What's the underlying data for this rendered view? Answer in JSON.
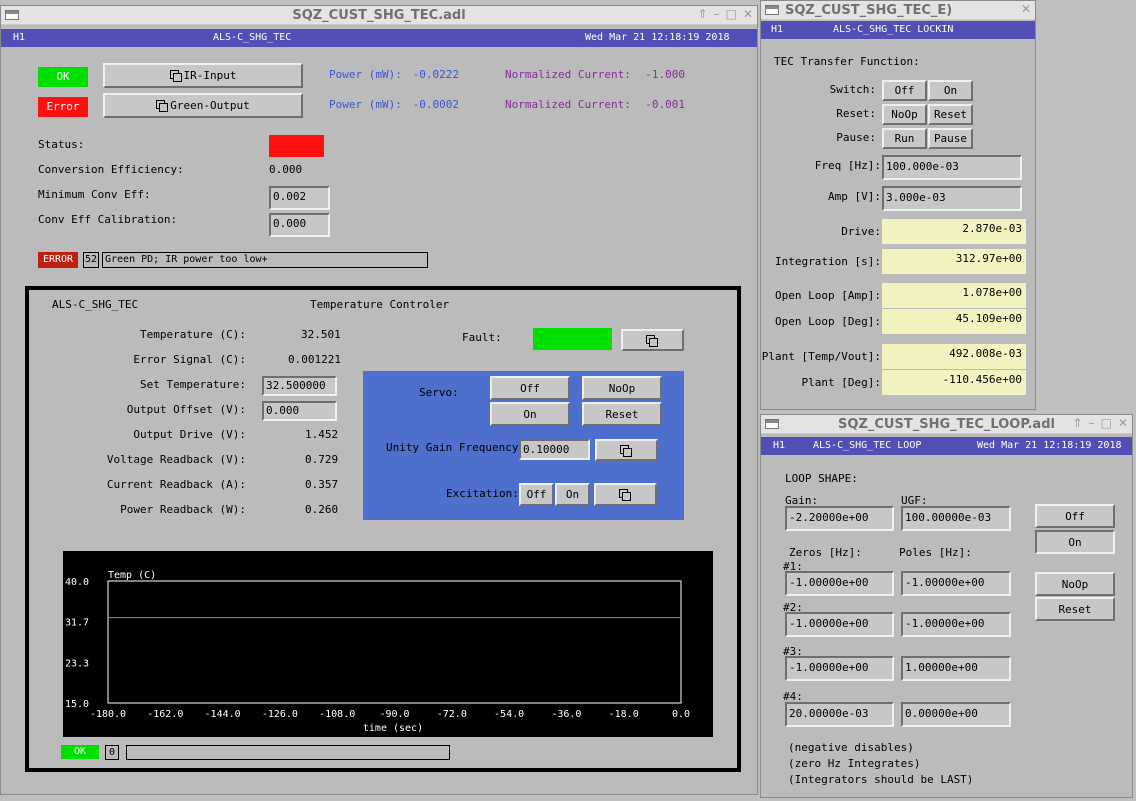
{
  "colors": {
    "header_bg": "#514eb6",
    "ok_green": "#00e000",
    "error_red": "#ff1010",
    "error_dark": "#c02010",
    "servo_panel": "#4e6fce",
    "readback_yellow": "#f3f3c2",
    "trace_green": "#2fd12f",
    "power_label_blue": "#3a55d8",
    "current_label_purple": "#8a2a9c"
  },
  "main": {
    "title": "SQZ_CUST_SHG_TEC.adl",
    "ifo": "H1",
    "system": "ALS-C_SHG_TEC",
    "datetime": "Wed Mar 21 12:18:19 2018",
    "ok_label": "OK",
    "error_label": "Error",
    "ir_button": "IR-Input",
    "green_button": "Green-Output",
    "power_label": "Power (mW):",
    "ir_power": "-0.0222",
    "green_power": "-0.0002",
    "norm_label": "Normalized Current:",
    "ir_norm": "-1.000",
    "green_norm": "-0.001",
    "status_label": "Status:",
    "conv_eff_label": "Conversion Efficiency:",
    "conv_eff_value": "0.000",
    "min_conv_label": "Minimum Conv Eff:",
    "min_conv_value": "0.002",
    "calib_label": "Conv Eff Calibration:",
    "calib_value": "0.000",
    "error_badge": "ERROR",
    "error_code": "52",
    "error_message": "Green PD; IR power too low+"
  },
  "temp": {
    "system": "ALS-C_SHG_TEC",
    "title": "Temperature Controler",
    "rows": [
      {
        "label": "Temperature (C):",
        "value": "32.501"
      },
      {
        "label": "Error Signal (C):",
        "value": "0.001221"
      },
      {
        "label": "Set Temperature:",
        "value": "32.500000"
      },
      {
        "label": "Output Offset (V):",
        "value": "0.000"
      },
      {
        "label": "Output Drive (V):",
        "value": "1.452"
      },
      {
        "label": "Voltage Readback (V):",
        "value": "0.729"
      },
      {
        "label": "Current Readback (A):",
        "value": "0.357"
      },
      {
        "label": "Power Readback (W):",
        "value": "0.260"
      }
    ],
    "fault_label": "Fault:",
    "servo_label": "Servo:",
    "off": "Off",
    "on": "On",
    "noop": "NoOp",
    "reset": "Reset",
    "ugf_label": "Unity Gain Frequency:",
    "ugf_value": "0.10000",
    "excitation_label": "Excitation:",
    "footer_ok": "OK",
    "footer_code": "0",
    "footer_message": ""
  },
  "chart_data": {
    "type": "line",
    "title": "Temp (C)",
    "xlabel": "time (sec)",
    "xlim": [
      -180,
      0
    ],
    "ylim": [
      15,
      40
    ],
    "x_ticks": [
      "-180.0",
      "-162.0",
      "-144.0",
      "-126.0",
      "-108.0",
      "-90.0",
      "-72.0",
      "-54.0",
      "-36.0",
      "-18.0",
      "0.0"
    ],
    "y_ticks": [
      "40.0",
      "31.7",
      "23.3",
      "15.0"
    ],
    "series": [
      {
        "x": [
          -180,
          0
        ],
        "y": [
          32.5,
          32.5
        ]
      }
    ]
  },
  "lockin": {
    "title": "SQZ_CUST_SHG_TEC_E)",
    "ifo": "H1",
    "name": "ALS-C_SHG_TEC LOCKIN",
    "heading": "TEC Transfer Function:",
    "switch_label": "Switch:",
    "reset_label": "Reset:",
    "pause_label": "Pause:",
    "off": "Off",
    "on": "On",
    "noop": "NoOp",
    "reset": "Reset",
    "run": "Run",
    "pause": "Pause",
    "freq_label": "Freq [Hz]:",
    "freq_value": "100.000e-03",
    "amp_label": "Amp [V]:",
    "amp_value": "3.000e-03",
    "readbacks": [
      {
        "label": "Drive:",
        "value": "2.870e-03"
      },
      {
        "label": "Integration [s]:",
        "value": "312.97e+00"
      },
      {
        "label": "Open Loop [Amp]:",
        "value": "1.078e+00"
      },
      {
        "label": "Open Loop [Deg]:",
        "value": "45.109e+00"
      },
      {
        "label": "Plant [Temp/Vout]:",
        "value": "492.008e-03"
      },
      {
        "label": "Plant [Deg]:",
        "value": "-110.456e+00"
      }
    ]
  },
  "loop": {
    "title": "SQZ_CUST_SHG_TEC_LOOP.adl",
    "ifo": "H1",
    "name": "ALS-C_SHG_TEC LOOP",
    "datetime": "Wed Mar 21 12:18:19 2018",
    "heading": "LOOP SHAPE:",
    "gain_label": "Gain:",
    "gain_value": "-2.20000e+00",
    "ugf_label": "UGF:",
    "ugf_value": "100.00000e-03",
    "zeros_label": "Zeros [Hz]:",
    "poles_label": "Poles [Hz]:",
    "rows": [
      {
        "label": "#1:",
        "zero": "-1.00000e+00",
        "pole": "-1.00000e+00"
      },
      {
        "label": "#2:",
        "zero": "-1.00000e+00",
        "pole": "-1.00000e+00"
      },
      {
        "label": "#3:",
        "zero": "-1.00000e+00",
        "pole": "1.00000e+00"
      },
      {
        "label": "#4:",
        "zero": "20.00000e-03",
        "pole": "0.00000e+00"
      }
    ],
    "off": "Off",
    "on": "On",
    "noop": "NoOp",
    "reset": "Reset",
    "notes": [
      "(negative disables)",
      "(zero Hz Integrates)",
      "(Integrators should be LAST)"
    ]
  }
}
